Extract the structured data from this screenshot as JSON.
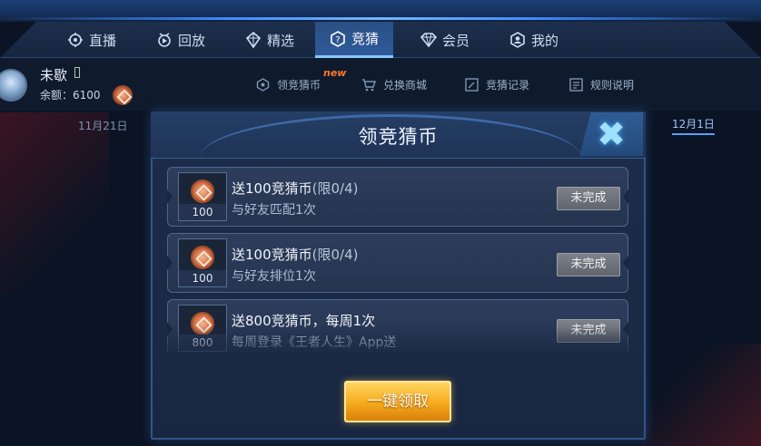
{
  "nav": {
    "tabs": [
      {
        "label": "直播",
        "icon": "live-icon"
      },
      {
        "label": "回放",
        "icon": "replay-icon"
      },
      {
        "label": "精选",
        "icon": "featured-icon"
      },
      {
        "label": "竞猜",
        "icon": "quiz-icon",
        "active": true
      },
      {
        "label": "会员",
        "icon": "diamond-icon"
      },
      {
        "label": "我的",
        "icon": "profile-icon"
      }
    ]
  },
  "user": {
    "name": "未歇",
    "balance_label": "余额：6100"
  },
  "menu": {
    "items": [
      {
        "label": "领竞猜币",
        "icon": "hexagon-icon"
      },
      {
        "label": "兑换商城",
        "icon": "cart-icon"
      },
      {
        "label": "竞猜记录",
        "icon": "edit-icon"
      },
      {
        "label": "规则说明",
        "icon": "document-icon"
      }
    ],
    "new_badge": "new"
  },
  "dates": {
    "left": "11月21日",
    "right": "12月1日"
  },
  "modal": {
    "title": "领竞猜币",
    "close_symbol": "✖",
    "tasks": [
      {
        "reward_amount": "100",
        "title": "送100竞猜币",
        "limit": "(限0/4)",
        "desc": "与好友匹配1次",
        "status": "未完成"
      },
      {
        "reward_amount": "100",
        "title": "送100竞猜币",
        "limit": "(限0/4)",
        "desc": "与好友排位1次",
        "status": "未完成"
      },
      {
        "reward_amount": "800",
        "title": "送800竞猜币，每周1次",
        "limit": "",
        "desc": "每周登录《王者人生》App送",
        "status": "未完成"
      }
    ],
    "claim_all_label": "一键领取"
  },
  "colors": {
    "accent": "#3f8cff",
    "claim_button": "#f5aa1c",
    "new_badge": "#ff7a29"
  }
}
